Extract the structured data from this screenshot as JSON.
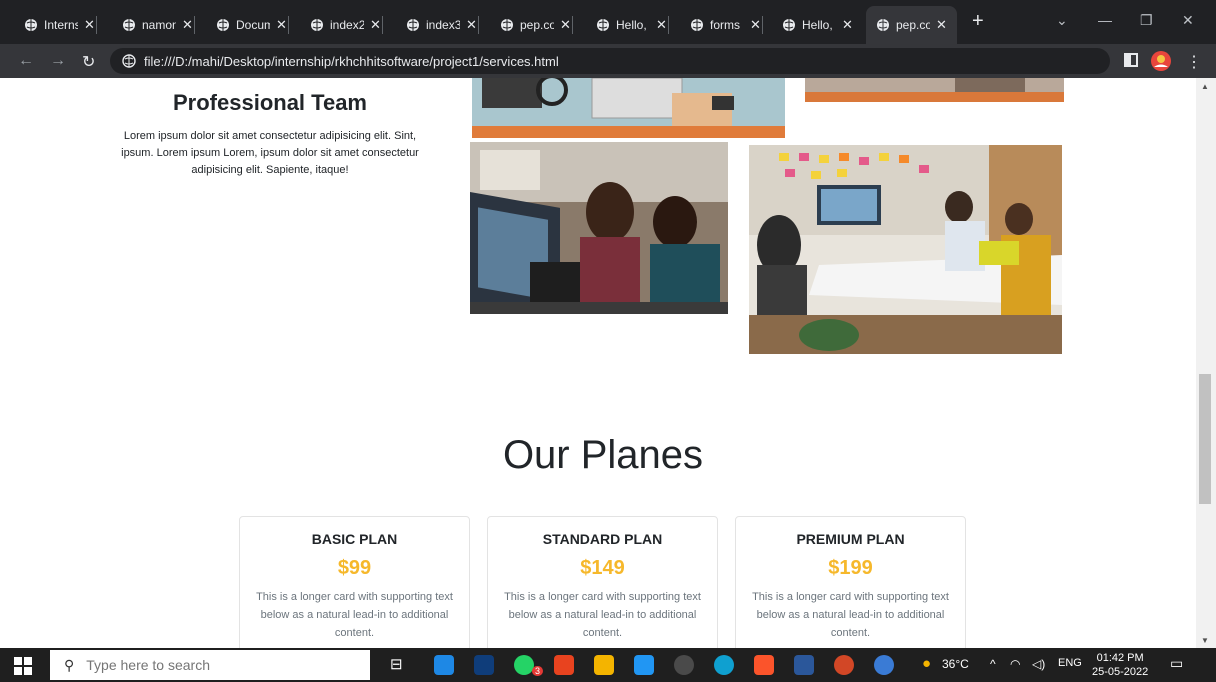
{
  "tabs": [
    {
      "label": "Interns",
      "active": false
    },
    {
      "label": "namon",
      "active": false
    },
    {
      "label": "Docum",
      "active": false
    },
    {
      "label": "index2",
      "active": false
    },
    {
      "label": "index3",
      "active": false
    },
    {
      "label": "pep.co",
      "active": false
    },
    {
      "label": "Hello,",
      "active": false
    },
    {
      "label": "forms",
      "active": false
    },
    {
      "label": "Hello,",
      "active": false
    },
    {
      "label": "pep.co",
      "active": true
    }
  ],
  "address": {
    "url": "file:///D:/mahi/Desktop/internship/rkhchhitsoftware/project1/services.html"
  },
  "team": {
    "title": "Professional Team",
    "text": "Lorem ipsum dolor sit amet consectetur adipisicing elit. Sint, ipsum. Lorem ipsum Lorem, ipsum dolor sit amet consectetur adipisicing elit. Sapiente, itaque!"
  },
  "plans": {
    "title": "Our Planes",
    "items": [
      {
        "name": "BASIC PLAN",
        "price": "$99",
        "text": "This is a longer card with supporting text below as a natural lead-in to additional content."
      },
      {
        "name": "STANDARD PLAN",
        "price": "$149",
        "text": "This is a longer card with supporting text below as a natural lead-in to additional content."
      },
      {
        "name": "PREMIUM PLAN",
        "price": "$199",
        "text": "This is a longer card with supporting text below as a natural lead-in to additional content."
      }
    ]
  },
  "taskbar": {
    "search_placeholder": "Type here to search",
    "weather": "36°C",
    "lang": "ENG",
    "time": "01:42 PM",
    "date": "25-05-2022",
    "badge": "3"
  },
  "colors": {
    "price": "#f6b82b",
    "chrome_dark": "#202124",
    "chrome_toolbar": "#35363a"
  }
}
